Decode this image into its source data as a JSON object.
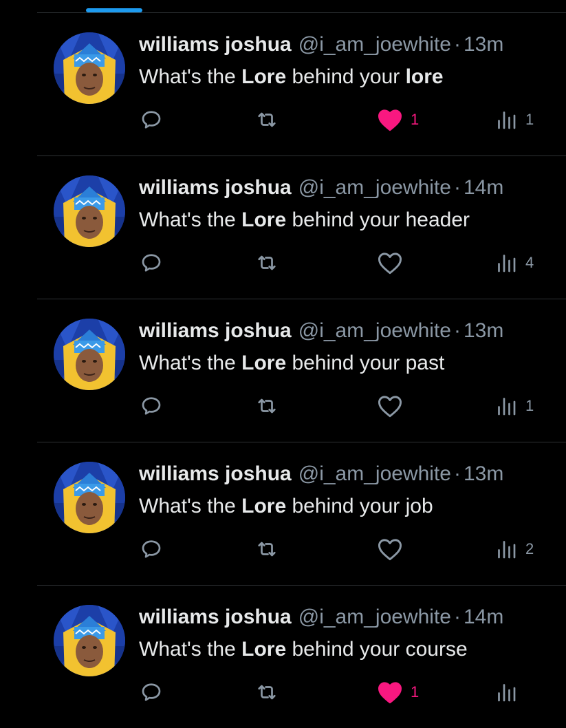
{
  "tweets": [
    {
      "display_name": "williams joshua",
      "handle": "@i_am_joewhite",
      "separator": "·",
      "time": "13m",
      "text_before": "What's the ",
      "text_bold": "Lore",
      "text_middle": " behind your ",
      "text_last": "lore",
      "text_last_bold": true,
      "liked": true,
      "like_count": "1",
      "views_count": "1"
    },
    {
      "display_name": "williams joshua",
      "handle": "@i_am_joewhite",
      "separator": "·",
      "time": "14m",
      "text_before": "What's the ",
      "text_bold": "Lore",
      "text_middle": " behind your ",
      "text_last": "header",
      "text_last_bold": false,
      "liked": false,
      "like_count": "",
      "views_count": "4"
    },
    {
      "display_name": "williams joshua",
      "handle": "@i_am_joewhite",
      "separator": "·",
      "time": "13m",
      "text_before": "What's the ",
      "text_bold": "Lore",
      "text_middle": " behind your ",
      "text_last": "past",
      "text_last_bold": false,
      "liked": false,
      "like_count": "",
      "views_count": "1"
    },
    {
      "display_name": "williams joshua",
      "handle": "@i_am_joewhite",
      "separator": "·",
      "time": "13m",
      "text_before": "What's the ",
      "text_bold": "Lore",
      "text_middle": " behind your ",
      "text_last": "job",
      "text_last_bold": false,
      "liked": false,
      "like_count": "",
      "views_count": "2"
    },
    {
      "display_name": "williams joshua",
      "handle": "@i_am_joewhite",
      "separator": "·",
      "time": "14m",
      "text_before": "What's the ",
      "text_bold": "Lore",
      "text_middle": " behind your ",
      "text_last": "course",
      "text_last_bold": false,
      "liked": true,
      "like_count": "1",
      "views_count": ""
    }
  ],
  "icons": {
    "reply": "reply-bubble-icon",
    "retweet": "retweet-icon",
    "like": "heart-icon",
    "views": "views-bar-chart-icon",
    "avatar": "profile-avatar-image"
  },
  "colors": {
    "background": "#000000",
    "primary_text": "#e7e9ea",
    "secondary_text": "#8b98a5",
    "divider": "#2f3336",
    "accent_blue": "#1d9bf0",
    "like_pink": "#f91880"
  }
}
